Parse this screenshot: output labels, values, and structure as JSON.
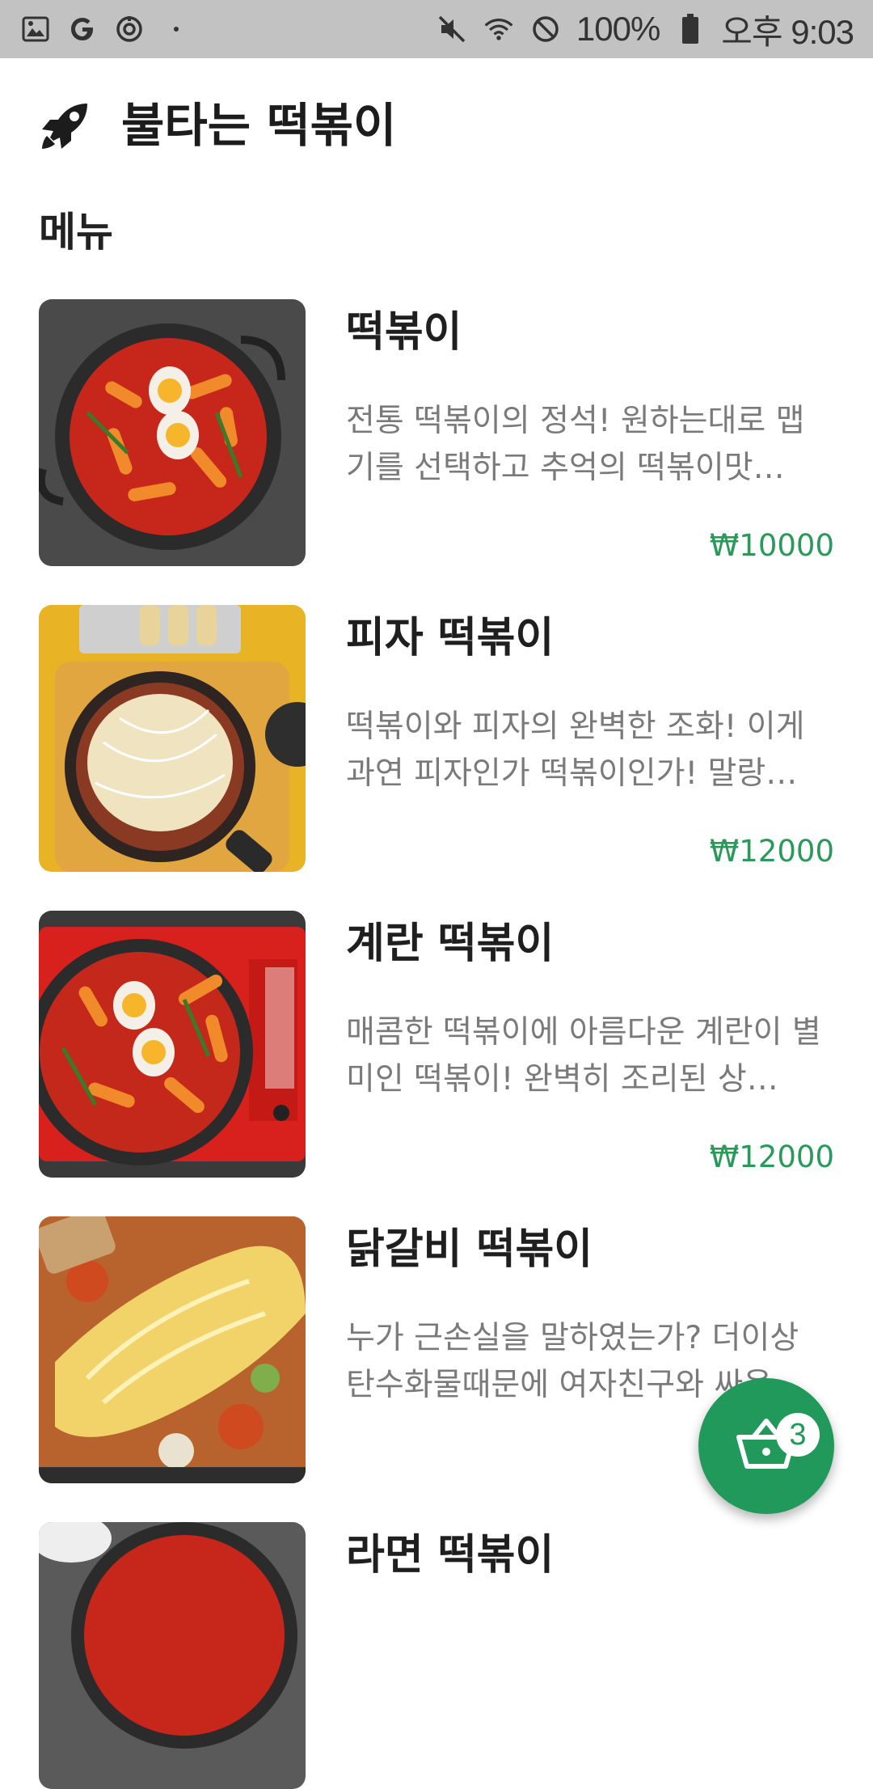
{
  "status_bar": {
    "battery": "100%",
    "time": "오후 9:03",
    "icons": [
      "image-icon",
      "google-icon",
      "sync-icon",
      "dot-icon",
      "mute-icon",
      "wifi-icon",
      "blocked-icon",
      "battery-icon"
    ]
  },
  "header": {
    "title": "불타는 떡볶이",
    "icon": "rocket-icon"
  },
  "section": {
    "title": "메뉴"
  },
  "menu": {
    "items": [
      {
        "name": "떡볶이",
        "description": "전통 떡볶이의 정석! 원하는대로 맵기를 선택하고 추억의 떡볶이맛…",
        "price": "₩10000"
      },
      {
        "name": "피자 떡볶이",
        "description": "떡볶이와 피자의 완벽한 조화! 이게 과연 피자인가 떡볶이인가! 말랑…",
        "price": "₩12000"
      },
      {
        "name": "계란 떡볶이",
        "description": "매콤한 떡볶이에 아름다운 계란이 별미인 떡볶이! 완벽히 조리된 상…",
        "price": "₩12000"
      },
      {
        "name": "닭갈비 떡볶이",
        "description": "누가 근손실을 말하였는가? 더이상 탄수화물때문에 여자친구와 싸움…",
        "price": ""
      },
      {
        "name": "라면 떡볶이",
        "description": "",
        "price": ""
      }
    ]
  },
  "cart": {
    "count": "3",
    "icon": "basket-icon"
  },
  "colors": {
    "accent": "#21995a",
    "price": "#2a9a5b",
    "status_bar": "#c2c2c2"
  }
}
